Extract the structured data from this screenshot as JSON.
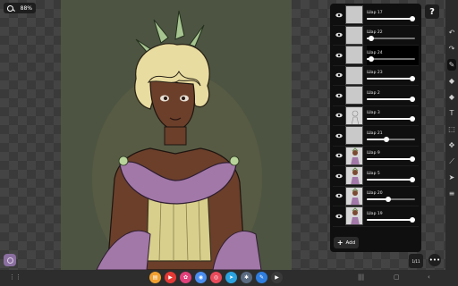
{
  "zoom": {
    "icon": "search-icon",
    "value": "88%"
  },
  "help": {
    "label": "?"
  },
  "toolbar": {
    "tools": [
      {
        "name": "undo-icon",
        "glyph": "↶"
      },
      {
        "name": "redo-icon",
        "glyph": "↷"
      },
      {
        "name": "brush-icon",
        "glyph": "✎",
        "active": true
      },
      {
        "name": "eraser-icon",
        "glyph": "◆"
      },
      {
        "name": "fill-bucket-icon",
        "glyph": "◆"
      },
      {
        "name": "text-icon",
        "glyph": "T"
      },
      {
        "name": "selection-icon",
        "glyph": "⬚"
      },
      {
        "name": "transform-icon",
        "glyph": "✥"
      },
      {
        "name": "eyedropper-icon",
        "glyph": "⟋"
      },
      {
        "name": "move-cursor-icon",
        "glyph": "➤"
      },
      {
        "name": "layers-list-icon",
        "glyph": "≡"
      }
    ]
  },
  "layers": {
    "items": [
      {
        "name": "Шар 17",
        "opacity": 0.95,
        "selected": false,
        "thumb": "plain"
      },
      {
        "name": "Шар 22",
        "opacity": 0.1,
        "selected": false,
        "thumb": "plain"
      },
      {
        "name": "Шар 24",
        "opacity": 0.1,
        "selected": true,
        "thumb": "plain"
      },
      {
        "name": "Шар 23",
        "opacity": 0.95,
        "selected": false,
        "thumb": "plain"
      },
      {
        "name": "Шар 2",
        "opacity": 0.95,
        "selected": false,
        "thumb": "plain"
      },
      {
        "name": "Шар 3",
        "opacity": 0.95,
        "selected": false,
        "thumb": "sketch"
      },
      {
        "name": "Шар 21",
        "opacity": 0.4,
        "selected": false,
        "thumb": "plain"
      },
      {
        "name": "Шар 9",
        "opacity": 0.95,
        "selected": false,
        "thumb": "figure"
      },
      {
        "name": "Шар 5",
        "opacity": 0.95,
        "selected": false,
        "thumb": "figure"
      },
      {
        "name": "Шар 20",
        "opacity": 0.45,
        "selected": false,
        "thumb": "figure"
      },
      {
        "name": "Шар 19",
        "opacity": 0.95,
        "selected": false,
        "thumb": "figure"
      }
    ],
    "add_label": "Add"
  },
  "stack_button": {
    "label": "1/11"
  },
  "colors": {
    "canvas_bg": "#4d5442",
    "skin": "#6b3f2a",
    "hair": "#e9dca0",
    "dress": "#a278a8",
    "corset": "#d8cf8c",
    "leaves": "#a6c48f"
  },
  "dock": {
    "apps": [
      {
        "name": "files-app-icon",
        "color": "#f0a030",
        "glyph": "▤"
      },
      {
        "name": "youtube-app-icon",
        "color": "#e53935",
        "glyph": "▶"
      },
      {
        "name": "gallery-app-icon",
        "color": "#e0407a",
        "glyph": "✿"
      },
      {
        "name": "chrome-app-icon",
        "color": "#4a8ef0",
        "glyph": "◉"
      },
      {
        "name": "screen-recorder-app-icon",
        "color": "#e84a5a",
        "glyph": "◎"
      },
      {
        "name": "telegram-app-icon",
        "color": "#2aa3e0",
        "glyph": "➤"
      },
      {
        "name": "settings-app-icon",
        "color": "#5a6a80",
        "glyph": "✱"
      },
      {
        "name": "samsung-notes-app-icon",
        "color": "#2e7de0",
        "glyph": "✎"
      },
      {
        "name": "play-store-app-icon",
        "color": "#3a3a3a",
        "glyph": "▶"
      }
    ]
  }
}
